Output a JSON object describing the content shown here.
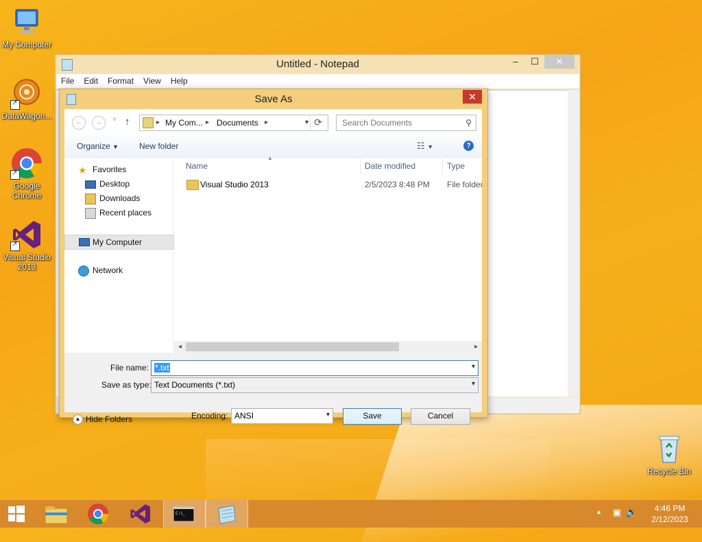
{
  "desktop": {
    "icons": [
      {
        "label": "My Computer"
      },
      {
        "label": "DataWagon..."
      },
      {
        "label": "Google Chrome"
      },
      {
        "label": "Visual Studio 2013"
      }
    ],
    "recycle_bin": "Recycle Bin"
  },
  "notepad": {
    "title": "Untitled - Notepad",
    "menu": [
      "File",
      "Edit",
      "Format",
      "View",
      "Help"
    ],
    "controls": {
      "minimize": "–",
      "maximize": "☐",
      "close": "✕"
    }
  },
  "dialog": {
    "title": "Save As",
    "close": "✕",
    "nav": {
      "back": "←",
      "forward": "→",
      "up": "↑",
      "recent": "˅"
    },
    "breadcrumb": [
      "My Com...",
      "Documents"
    ],
    "search_placeholder": "Search Documents",
    "toolbar": {
      "organize": "Organize",
      "new_folder": "New folder"
    },
    "nav_pane": {
      "favorites": "Favorites",
      "desktop": "Desktop",
      "downloads": "Downloads",
      "recent_places": "Recent places",
      "my_computer": "My Computer",
      "network": "Network"
    },
    "columns": {
      "name": "Name",
      "date_modified": "Date modified",
      "type": "Type"
    },
    "files": [
      {
        "name": "Visual Studio 2013",
        "date": "2/5/2023 8:48 PM",
        "type": "File folder"
      }
    ],
    "file_name_label": "File name:",
    "file_name_value": "*.txt",
    "save_type_label": "Save as type:",
    "save_type_value": "Text Documents (*.txt)",
    "encoding_label": "Encoding:",
    "encoding_value": "ANSI",
    "save_button": "Save",
    "cancel_button": "Cancel",
    "hide_folders": "Hide Folders"
  },
  "taskbar": {
    "clock_time": "4:46 PM",
    "clock_date": "2/12/2023"
  },
  "colors": {
    "desktop": "#f5a517",
    "dialog_frame": "#f4ce7c",
    "taskbar": "#d7892c",
    "close_red": "#c7392b",
    "selection": "#3399ff"
  }
}
